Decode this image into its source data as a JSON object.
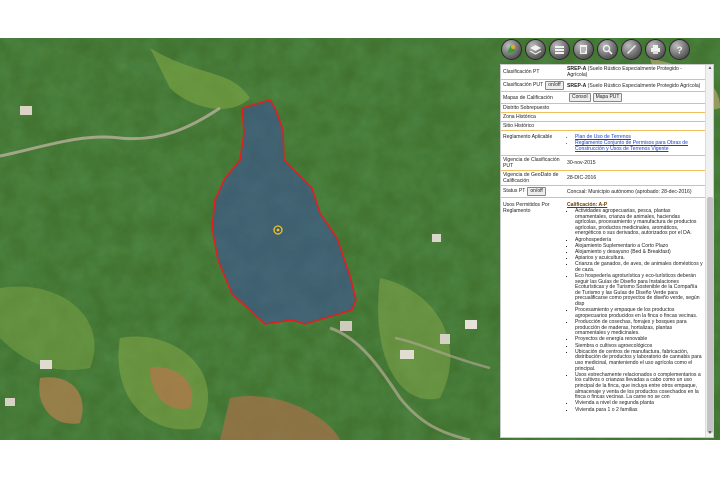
{
  "toolbar": {
    "buttons": [
      {
        "icon": "map-layers-icon"
      },
      {
        "icon": "layers-icon"
      },
      {
        "icon": "stacked-layers-icon"
      },
      {
        "icon": "report-icon"
      },
      {
        "icon": "search-icon"
      },
      {
        "icon": "measure-icon"
      },
      {
        "icon": "print-icon"
      },
      {
        "icon": "help-icon"
      }
    ]
  },
  "panel": {
    "rows": {
      "clasificacion_pt": {
        "label": "Clasificación PT",
        "code": "SREP-A",
        "desc": "(Suelo Rústico Especialmente Protegido - Agrícola)"
      },
      "clasificacion_put": {
        "label": "Clasificación PUT",
        "toggle": "on/off",
        "code": "SREP-A",
        "desc": "(Suelo Rústico Especialmente Protegido Agrícola)"
      },
      "mapas": {
        "label": "Mapas de Calificación",
        "btn1": "Consol",
        "btn2": "Mapa PUT"
      },
      "distrito": {
        "label": "Distrito Sobrepuesto"
      },
      "zona": {
        "label": "Zona Histórica"
      },
      "sitio": {
        "label": "Sitio Histórico"
      },
      "reglamento": {
        "label": "Reglamento Aplicable",
        "links": [
          "Plan de Uso de Terrenos",
          "Reglamento Conjunto de Permisos para Obras de Construcción y Usos de Terrenos Vigente"
        ]
      },
      "vigencia_put": {
        "label": "Vigencia de Clasificación PUT",
        "value": "30-nov-2015"
      },
      "vigencia_geo": {
        "label": "Vigencia de GeoDato de Calificación",
        "value": "28-DIC-2016"
      },
      "status_pt": {
        "label": "Status PT",
        "toggle": "on/off",
        "value": "Concsal: Municipio autónomo (aprobado: 28-dec-2016)"
      }
    },
    "usos": {
      "label": "Usos Permitidos Por Reglamento",
      "title": "Calificación: A-P",
      "items": [
        "Actividades agropecuarias, pesca, plantas ornamentales, crianza de animales, haciendas agrícolas, procesamiento y manufactura de productos agrícolas, productos medicinales, aromáticos, energéticos o sus derivados, autorizados por el DA.",
        "Agrohospedería",
        "Alojamiento Suplementario a Corto Plazo",
        "Alojamiento y desayuno (Bed & Breakfast)",
        "Apiarios y acuicultura.",
        "Crianza de ganados, de aves, de animales domésticos y de caza.",
        "Eco hospedería agroturística y eco-turísticos deberán seguir las Guías de Diseño para Instalaciones Ecoturísticas y de Turismo Sostenible de la Compañía de Turismo y las Guías de Diseño Verde para precualificarse como proyectos de diseño verde, según disp",
        "Procesamiento y empaque de los productos agropecuarios producidos en la finca o fincas vecinas.",
        "Producción de cosechas, forrajes y bosques para producción de maderas, hortalizas, plantas ornamentales y medicinales.",
        "Proyectos de energía renovable",
        "Siembra o cultivos agroecológicos",
        "Ubicación de centros de manufactura, fabricación, distribución de productos y laboratorio de cannabis para uso medicinal, manteniendo el uso agrícola como el principal.",
        "Usos estrechamente relacionados o complementarios a los cultivos o crianzas llevadas a cabo como un uso principal de la finca, que incluya entre otros empaque, almacenaje y venta de los productos cosechados en la finca o fincas vecinas. La carne no se con",
        "Vivienda a nivel de segunda planta",
        "Vivienda para 1 o 2 familias"
      ]
    }
  }
}
